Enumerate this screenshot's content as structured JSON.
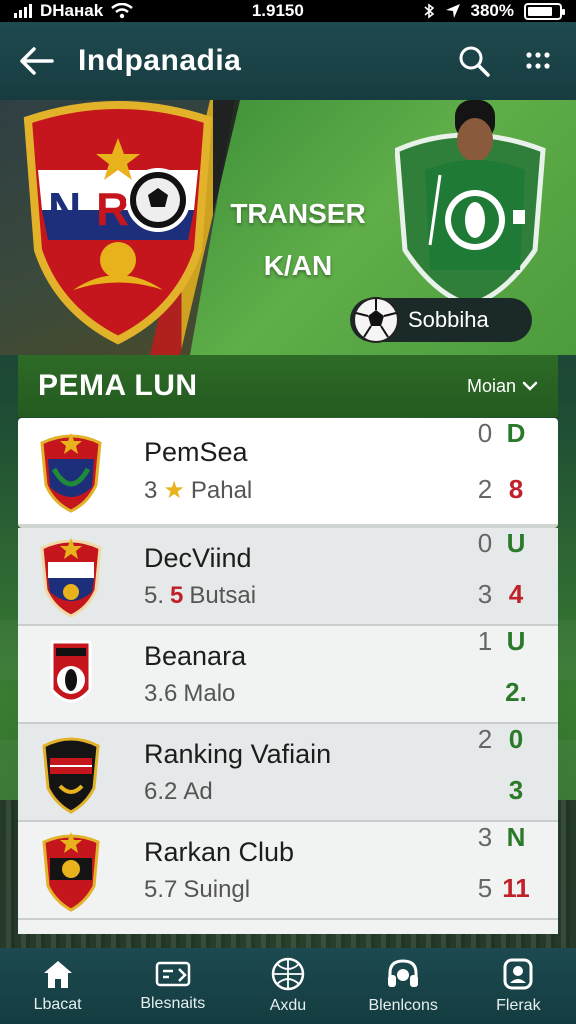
{
  "status_bar": {
    "carrier": "DHaнak",
    "time": "1.9150",
    "battery": "380%"
  },
  "app_bar": {
    "title": "Indpanadia",
    "back_icon": "arrow-left-icon",
    "search_icon": "search-icon",
    "more_icon": "grid-dots-icon"
  },
  "hero": {
    "transfer_line1": "TRANSER",
    "transfer_line2": "K/AN",
    "pill_label": "Sobbiha"
  },
  "league": {
    "name": "PEMA LUN",
    "menu_label": "Moian"
  },
  "teams": [
    {
      "name": "PemSea",
      "sub_prefix": "3",
      "sub_mark": "★",
      "sub_text": "Pahal",
      "s1a": "0",
      "s1b": "D",
      "s2a": "2",
      "s2b": "8",
      "s1b_color": "green",
      "s2b_color": "red"
    },
    {
      "name": "DecViind",
      "sub_prefix": "5.",
      "sub_mark": "5",
      "sub_text": "Butsai",
      "s1a": "0",
      "s1b": "U",
      "s2a": "3",
      "s2b": "4",
      "s1b_color": "green",
      "s2b_color": "red"
    },
    {
      "name": "Beanara",
      "sub_prefix": "3.6",
      "sub_mark": "",
      "sub_text": "Malo",
      "s1a": "1",
      "s1b": "U",
      "s2a": "",
      "s2b": "2.",
      "s1b_color": "green",
      "s2b_color": "green"
    },
    {
      "name": "Ranking Vafiain",
      "sub_prefix": "6.2",
      "sub_mark": "",
      "sub_text": "Ad",
      "s1a": "2",
      "s1b": "0",
      "s2a": "",
      "s2b": "3",
      "s1b_color": "green",
      "s2b_color": "green"
    },
    {
      "name": "Rarkan Club",
      "sub_prefix": "5.7",
      "sub_mark": "",
      "sub_text": "Suingl",
      "s1a": "3",
      "s1b": "N",
      "s2a": "5",
      "s2b": "11",
      "s1b_color": "green",
      "s2b_color": "red"
    }
  ],
  "bottom_nav": [
    {
      "label": "Lbacat",
      "icon": "home-icon"
    },
    {
      "label": "Blesnaits",
      "icon": "ticket-icon"
    },
    {
      "label": "Axdu",
      "icon": "ball-icon"
    },
    {
      "label": "Blenlcons",
      "icon": "headset-icon"
    },
    {
      "label": "Flerak",
      "icon": "profile-icon"
    }
  ],
  "colors": {
    "appbar": "#1f4a4f",
    "league_header": "#2e6b27",
    "score_green": "#2a7a2a",
    "score_red": "#c0202a"
  }
}
